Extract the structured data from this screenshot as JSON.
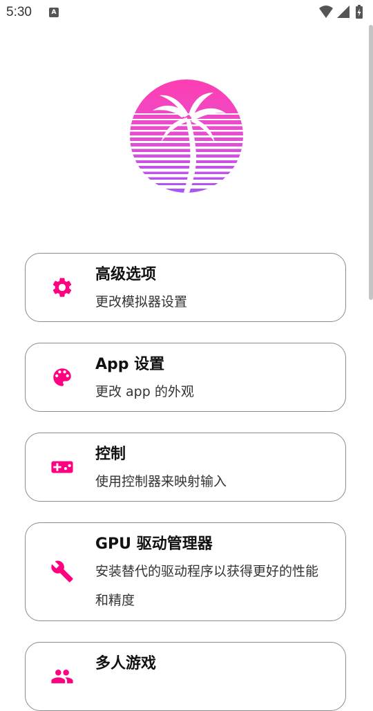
{
  "status_bar": {
    "time": "5:30",
    "notification_icon": "app-notification-icon",
    "wifi_icon": "wifi-icon",
    "signal_icon": "cell-signal-icon",
    "battery_icon": "battery-charging-icon"
  },
  "logo": {
    "icon": "palm-tree-sunset-logo",
    "gradient_top": "#ff3db0",
    "gradient_bottom": "#a855f7"
  },
  "accent_color": "#ff0080",
  "menu": {
    "items": [
      {
        "icon": "gear-icon",
        "title": "高级选项",
        "description": "更改模拟器设置"
      },
      {
        "icon": "palette-icon",
        "title": "App 设置",
        "description": "更改 app 的外观"
      },
      {
        "icon": "gamepad-icon",
        "title": "控制",
        "description": "使用控制器来映射输入"
      },
      {
        "icon": "wrench-icon",
        "title": "GPU 驱动管理器",
        "description": "安装替代的驱动程序以获得更好的性能和精度"
      },
      {
        "icon": "multiplayer-icon",
        "title": "多人游戏",
        "description": ""
      }
    ]
  }
}
